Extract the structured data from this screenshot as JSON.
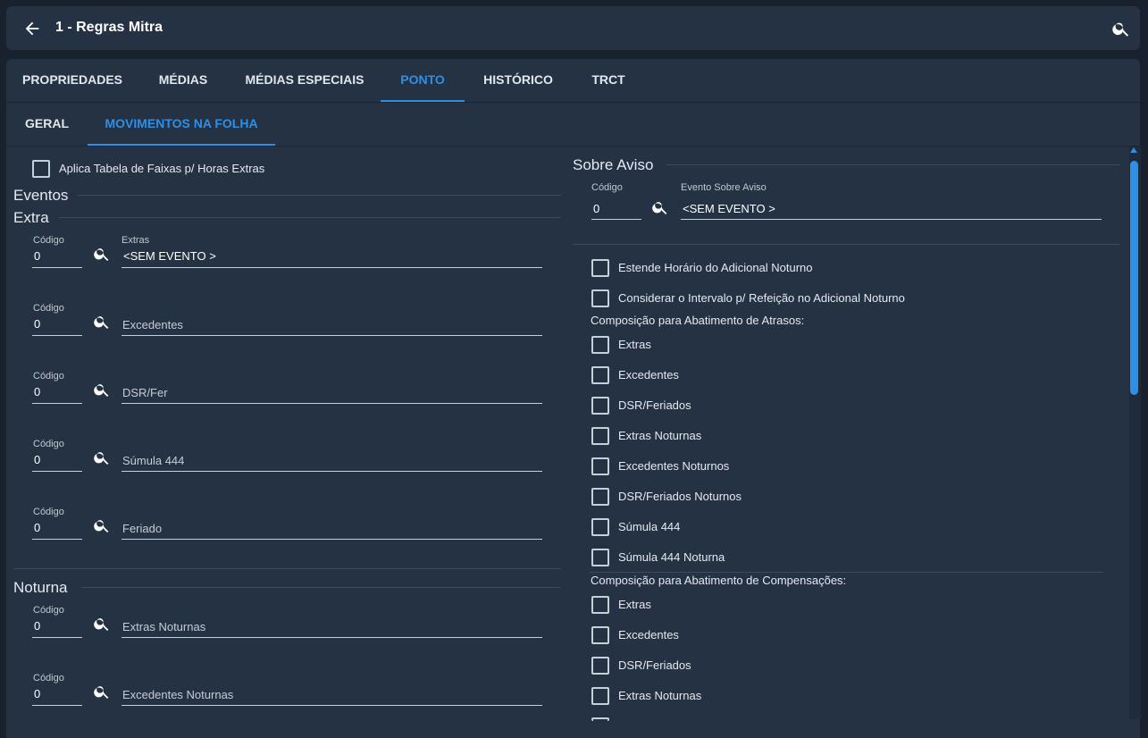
{
  "header": {
    "title": "1 - Regras Mitra"
  },
  "tabs_primary": [
    {
      "label": "PROPRIEDADES"
    },
    {
      "label": "MÉDIAS"
    },
    {
      "label": "MÉDIAS ESPECIAIS"
    },
    {
      "label": "PONTO"
    },
    {
      "label": "HISTÓRICO"
    },
    {
      "label": "TRCT"
    }
  ],
  "tabs_secondary": [
    {
      "label": "GERAL"
    },
    {
      "label": "MOVIMENTOS NA FOLHA"
    }
  ],
  "left": {
    "aplica_label": "Aplica Tabela de Faixas p/ Horas Extras",
    "eventos_title": "Eventos",
    "extra_title": "Extra",
    "noturna_title": "Noturna",
    "extra_fields": [
      {
        "code_label": "Código",
        "code_value": "0",
        "event_label": "Extras",
        "event_value": "<SEM EVENTO >",
        "placeholder": ""
      },
      {
        "code_label": "Código",
        "code_value": "0",
        "event_label": "",
        "event_value": "",
        "placeholder": "Excedentes"
      },
      {
        "code_label": "Código",
        "code_value": "0",
        "event_label": "",
        "event_value": "",
        "placeholder": "DSR/Fer"
      },
      {
        "code_label": "Código",
        "code_value": "0",
        "event_label": "",
        "event_value": "",
        "placeholder": "Súmula 444"
      },
      {
        "code_label": "Código",
        "code_value": "0",
        "event_label": "",
        "event_value": "",
        "placeholder": "Feriado"
      }
    ],
    "noturna_fields": [
      {
        "code_label": "Código",
        "code_value": "0",
        "placeholder": "Extras Noturnas"
      },
      {
        "code_label": "Código",
        "code_value": "0",
        "placeholder": "Excedentes Noturnas"
      }
    ]
  },
  "right": {
    "sobre_aviso_title": "Sobre Aviso",
    "code_label": "Código",
    "code_value": "0",
    "event_label": "Evento Sobre Aviso",
    "event_value": "<SEM EVENTO >",
    "checkboxes": [
      {
        "label": "Estende Horário do Adicional Noturno"
      },
      {
        "label": "Considerar o Intervalo p/ Refeição no Adicional Noturno"
      }
    ],
    "atrasos_title": "Composição para Abatimento de Atrasos:",
    "atrasos": [
      {
        "label": "Extras"
      },
      {
        "label": "Excedentes"
      },
      {
        "label": "DSR/Feriados"
      },
      {
        "label": "Extras Noturnas"
      },
      {
        "label": "Excedentes Noturnos"
      },
      {
        "label": "DSR/Feriados Noturnos"
      },
      {
        "label": "Súmula 444"
      },
      {
        "label": "Súmula 444 Noturna"
      }
    ],
    "compensacoes_title": "Composição para Abatimento de Compensações:",
    "compensacoes": [
      {
        "label": "Extras"
      },
      {
        "label": "Excedentes"
      },
      {
        "label": "DSR/Feriados"
      },
      {
        "label": "Extras Noturnas"
      }
    ]
  },
  "colors": {
    "accent": "#2e8fe6",
    "panel": "#243244",
    "background": "#18212d"
  }
}
